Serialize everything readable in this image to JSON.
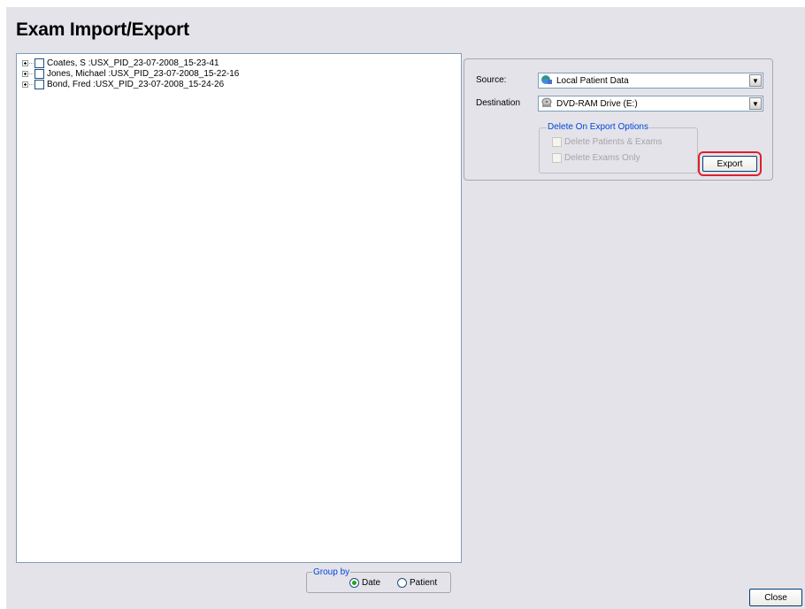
{
  "title": "Exam Import/Export",
  "tree": {
    "items": [
      {
        "label": "Coates, S  :USX_PID_23-07-2008_15-23-41"
      },
      {
        "label": "Jones, Michael  :USX_PID_23-07-2008_15-22-16"
      },
      {
        "label": "Bond, Fred  :USX_PID_23-07-2008_15-24-26"
      }
    ]
  },
  "source": {
    "label": "Source:",
    "value": "Local Patient Data",
    "icon": "globe-database-icon"
  },
  "destination": {
    "label": "Destination",
    "value": "DVD-RAM Drive (E:)",
    "icon": "dvd-drive-icon"
  },
  "delete_options": {
    "legend": "Delete On Export Options",
    "patients_exams": "Delete Patients & Exams",
    "exams_only": "Delete Exams Only"
  },
  "export_label": "Export",
  "group_by": {
    "legend": "Group by",
    "date": "Date",
    "patient": "Patient",
    "selected": "Date"
  },
  "close_label": "Close",
  "colors": {
    "accent": "#e0202a",
    "legend": "#0046d5",
    "background": "#e4e3ea"
  }
}
